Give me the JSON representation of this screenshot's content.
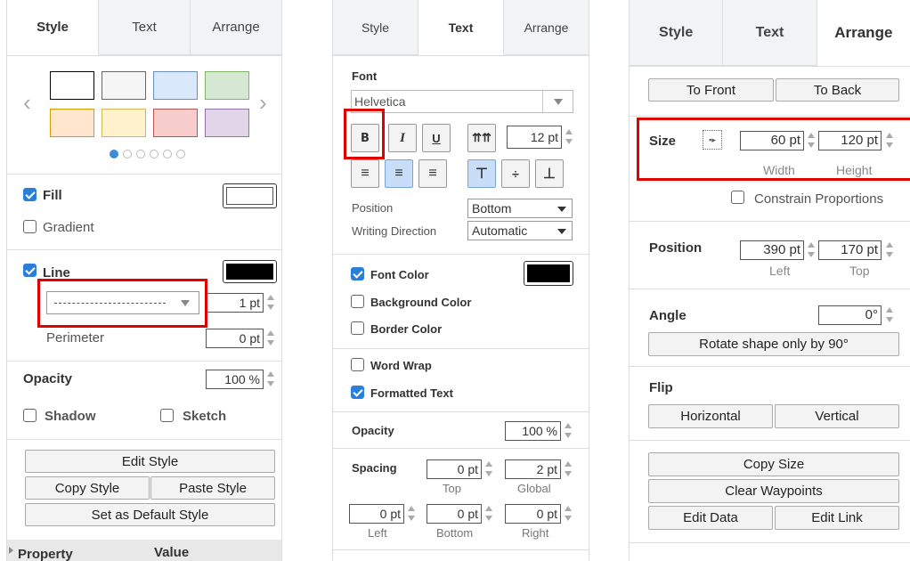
{
  "panel1": {
    "tabs": [
      "Style",
      "Text",
      "Arrange"
    ],
    "fill_label": "Fill",
    "gradient_label": "Gradient",
    "line_label": "Line",
    "line_width": "1 pt",
    "perimeter_label": "Perimeter",
    "perimeter_value": "0 pt",
    "opacity_label": "Opacity",
    "opacity_value": "100 %",
    "shadow_label": "Shadow",
    "sketch_label": "Sketch",
    "edit_style": "Edit Style",
    "copy_style": "Copy Style",
    "paste_style": "Paste Style",
    "set_default": "Set as Default Style",
    "property_header": "Property",
    "value_header": "Value",
    "swatches_top": [
      "#ffffff",
      "#f5f5f5",
      "#dae8fc",
      "#d5e8d4"
    ],
    "swatches_bottom": [
      "#ffe6cc",
      "#fff2cc",
      "#f8cecc",
      "#e1d5e7"
    ],
    "swatch_borders_top": [
      "#000000",
      "#666666",
      "#6c8ebf",
      "#82b366"
    ],
    "swatch_borders_bottom": [
      "#d79b00",
      "#d6b656",
      "#b85450",
      "#9673a6"
    ]
  },
  "panel2": {
    "tabs": [
      "Style",
      "Text",
      "Arrange"
    ],
    "font_label": "Font",
    "font_name": "Helvetica",
    "bold_glyph": "B",
    "italic_glyph": "I",
    "underline_glyph": "U",
    "font_size": "12 pt",
    "position_label": "Position",
    "position_value": "Bottom",
    "writing_dir_label": "Writing Direction",
    "writing_dir_value": "Automatic",
    "font_color_label": "Font Color",
    "bg_color_label": "Background Color",
    "border_color_label": "Border Color",
    "word_wrap_label": "Word Wrap",
    "formatted_text_label": "Formatted Text",
    "opacity_label": "Opacity",
    "opacity_value": "100 %",
    "spacing_label": "Spacing",
    "spacing_top": "0 pt",
    "spacing_global": "2 pt",
    "top_label": "Top",
    "global_label": "Global",
    "spacing_left": "0 pt",
    "spacing_bottom": "0 pt",
    "spacing_right": "0 pt",
    "left_label": "Left",
    "bottom_label": "Bottom",
    "right_label": "Right"
  },
  "panel3": {
    "tabs": [
      "Style",
      "Text",
      "Arrange"
    ],
    "to_front": "To Front",
    "to_back": "To Back",
    "size_label": "Size",
    "width_value": "60 pt",
    "height_value": "120 pt",
    "width_label": "Width",
    "height_label": "Height",
    "constrain_label": "Constrain Proportions",
    "position_label": "Position",
    "left_value": "390 pt",
    "top_value": "170 pt",
    "left_label": "Left",
    "top_label": "Top",
    "angle_label": "Angle",
    "angle_value": "0°",
    "rotate_btn": "Rotate shape only by 90°",
    "flip_label": "Flip",
    "horizontal_btn": "Horizontal",
    "vertical_btn": "Vertical",
    "copy_size": "Copy Size",
    "clear_waypoints": "Clear Waypoints",
    "edit_data": "Edit Data",
    "edit_link": "Edit Link"
  }
}
